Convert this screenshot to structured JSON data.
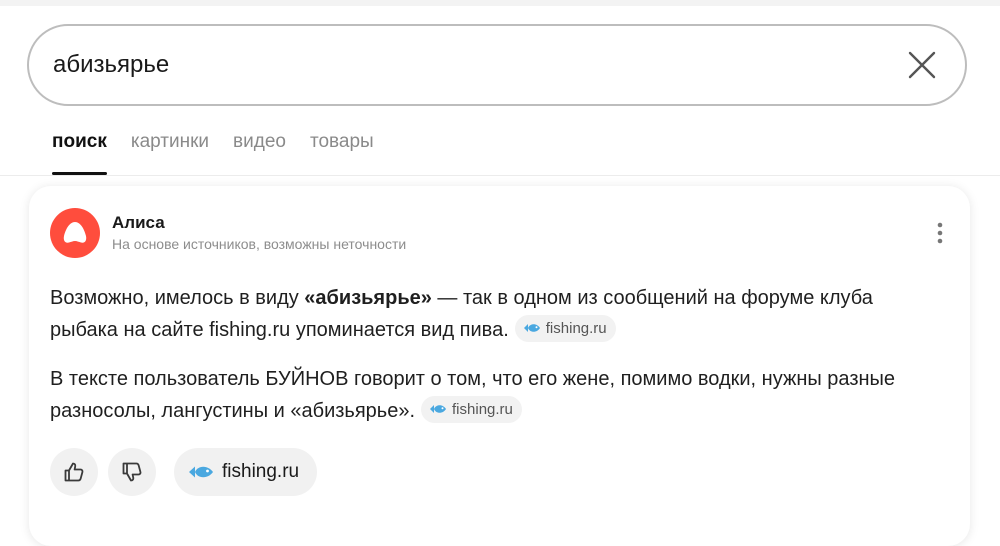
{
  "search": {
    "query": "абизьярье"
  },
  "tabs": [
    {
      "label": "поиск"
    },
    {
      "label": "картинки"
    },
    {
      "label": "видео"
    },
    {
      "label": "товары"
    }
  ],
  "alice": {
    "name": "Алиса",
    "subtitle": "На основе источников, возможны неточности",
    "logo_color": "#ff4d3d",
    "paragraph1": {
      "before": "Возможно, имелось в виду ",
      "bold": "«абизьярье»",
      "after": " — так в одном из сообщений на форуме клуба рыбака на сайте fishing.ru упоминается вид пива.",
      "source": "fishing.ru"
    },
    "paragraph2": {
      "text": "В тексте пользователь БУЙНОВ говорит о том, что его жене, помимо водки, нужны разные разносолы, лангустины и «абизьярье».",
      "source": "fishing.ru"
    },
    "actions": {
      "like_icon": "thumb-up-icon",
      "dislike_icon": "thumb-down-icon",
      "source_label": "fishing.ru",
      "source_icon": "fish-icon",
      "fish_color": "#4aa8e0"
    }
  }
}
